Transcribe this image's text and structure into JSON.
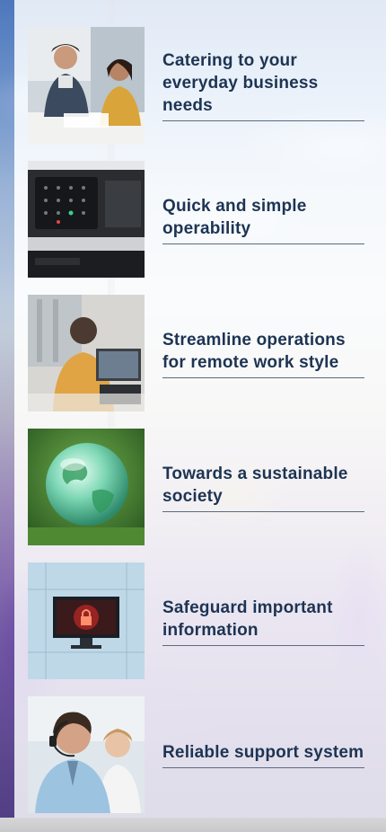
{
  "features": [
    {
      "id": "business-needs",
      "label": "Catering to your everyday business needs",
      "icon": "people-meeting-icon"
    },
    {
      "id": "operability",
      "label": "Quick and simple operability",
      "icon": "printer-panel-icon"
    },
    {
      "id": "remote-work",
      "label": "Streamline operations for remote work style",
      "icon": "remote-worker-icon"
    },
    {
      "id": "sustainable",
      "label": "Towards a sustainable society",
      "icon": "globe-icon"
    },
    {
      "id": "security",
      "label": "Safeguard important information",
      "icon": "lock-screen-icon"
    },
    {
      "id": "support",
      "label": "Reliable support system",
      "icon": "headset-operator-icon"
    }
  ],
  "colors": {
    "label_text": "#1d3453",
    "underline": "#5a6b80",
    "panel": "#ffffff"
  }
}
